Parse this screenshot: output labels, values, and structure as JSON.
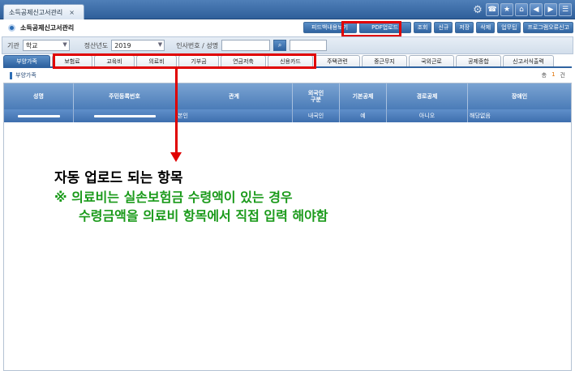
{
  "window": {
    "tab_title": "소득공제신고서관리",
    "tab_close": "×"
  },
  "toolbar_icons": [
    "gear-icon",
    "phone-icon",
    "star-icon",
    "home-icon",
    "prev-icon",
    "next-icon",
    "menu-icon"
  ],
  "header": {
    "title": "소득공제신고서관리"
  },
  "actions": {
    "feedback": "피드백내용보기",
    "pdf_upload": "PDF업로드",
    "search": "조회",
    "new": "신규",
    "save": "저장",
    "delete": "삭제",
    "work_help": "업무팁",
    "program_error": "프로그램오류신고"
  },
  "filter": {
    "org_label": "기관",
    "org_value": "학교",
    "year_label": "정산년도",
    "year_value": "2019",
    "person_label": "인사번호 / 성명",
    "person_value": "",
    "name_value": ""
  },
  "tabs": [
    {
      "label": "부양가족"
    },
    {
      "label": "보험료"
    },
    {
      "label": "교육비"
    },
    {
      "label": "의료비"
    },
    {
      "label": "기부금"
    },
    {
      "label": "연금저축"
    },
    {
      "label": "신용카드"
    },
    {
      "label": "주택관련"
    },
    {
      "label": "중근무지"
    },
    {
      "label": "국외근로"
    },
    {
      "label": "공제종합"
    },
    {
      "label": "신고서식출력"
    }
  ],
  "section": {
    "title": "부양가족",
    "count_label": "총",
    "count_value": "1",
    "count_unit": "건"
  },
  "grid": {
    "headers": [
      "성명",
      "주민등록번호",
      "관계",
      "외국인\n구분",
      "기본공제",
      "경로공제",
      "장애인"
    ],
    "rows": [
      {
        "name": "",
        "rrn": "",
        "relation": "본인",
        "foreign": "내국인",
        "basic": "예",
        "elder": "아니오",
        "disabled": "해당없음"
      }
    ]
  },
  "annotation": {
    "line1": "자동 업로드 되는 항목",
    "line2": "※ 의료비는 실손보험금 수령액이 있는 경우",
    "line3": "수령금액을 의료비 항목에서 직접 입력 해야함"
  },
  "colors": {
    "accent": "#2f63a0",
    "highlight": "#e00000",
    "note": "#1a9a1a"
  }
}
